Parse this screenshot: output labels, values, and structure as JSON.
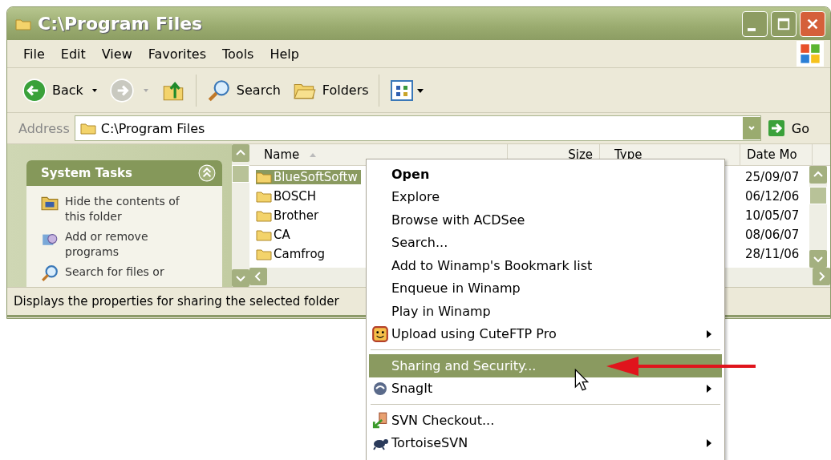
{
  "window": {
    "title": "C:\\Program Files"
  },
  "menu_bar": [
    "File",
    "Edit",
    "View",
    "Favorites",
    "Tools",
    "Help"
  ],
  "toolbar": [
    {
      "kind": "back",
      "label": "Back",
      "disabled": false
    },
    {
      "kind": "forward",
      "disabled": true
    },
    {
      "kind": "up"
    },
    {
      "kind": "search",
      "label": "Search"
    },
    {
      "kind": "folders",
      "label": "Folders"
    },
    {
      "kind": "views"
    }
  ],
  "address_bar": {
    "label": "Address",
    "value": "C:\\Program Files",
    "go_label": "Go"
  },
  "system_tasks": {
    "title": "System Tasks",
    "expanded": true,
    "tasks": [
      {
        "kind": "hide",
        "label": "Hide the contents of this folder"
      },
      {
        "kind": "add-remove",
        "label": "Add or remove programs"
      },
      {
        "kind": "search",
        "label": "Search for files or"
      }
    ]
  },
  "file_list": {
    "columns": [
      "Name",
      "Size",
      "Type",
      "Date Mo"
    ],
    "rows": [
      {
        "name": "BlueSoftSoftw",
        "date": "25/09/07",
        "selected": true
      },
      {
        "name": "BOSCH",
        "date": "06/12/06",
        "selected": false
      },
      {
        "name": "Brother",
        "date": "10/05/07",
        "selected": false
      },
      {
        "name": "CA",
        "date": "08/06/07",
        "selected": false
      },
      {
        "name": "Camfrog",
        "date": "28/11/06",
        "selected": false
      }
    ]
  },
  "status_bar": "Displays the properties for sharing the selected folder",
  "context_menu": [
    {
      "kind": "plain",
      "label": "Open",
      "default": true,
      "submenu": false,
      "selected": false
    },
    {
      "kind": "plain",
      "label": "Explore",
      "default": false,
      "submenu": false,
      "selected": false
    },
    {
      "kind": "plain",
      "label": "Browse with ACDSee",
      "default": false,
      "submenu": false,
      "selected": false
    },
    {
      "kind": "plain",
      "label": "Search...",
      "default": false,
      "submenu": false,
      "selected": false
    },
    {
      "kind": "plain",
      "label": "Add to Winamp's Bookmark list",
      "default": false,
      "submenu": false,
      "selected": false
    },
    {
      "kind": "plain",
      "label": "Enqueue in Winamp",
      "default": false,
      "submenu": false,
      "selected": false
    },
    {
      "kind": "plain",
      "label": "Play in Winamp",
      "default": false,
      "submenu": false,
      "selected": false
    },
    {
      "kind": "smiley",
      "label": "Upload using CuteFTP Pro",
      "default": false,
      "submenu": true,
      "selected": false
    },
    {
      "kind": "separator"
    },
    {
      "kind": "plain",
      "label": "Sharing and Security...",
      "default": false,
      "submenu": false,
      "selected": true
    },
    {
      "kind": "swirl",
      "label": "SnagIt",
      "default": false,
      "submenu": true,
      "selected": false
    },
    {
      "kind": "separator"
    },
    {
      "kind": "checkout",
      "label": "SVN Checkout...",
      "default": false,
      "submenu": false,
      "selected": false
    },
    {
      "kind": "turtle",
      "label": "TortoiseSVN",
      "default": false,
      "submenu": true,
      "selected": false
    }
  ]
}
